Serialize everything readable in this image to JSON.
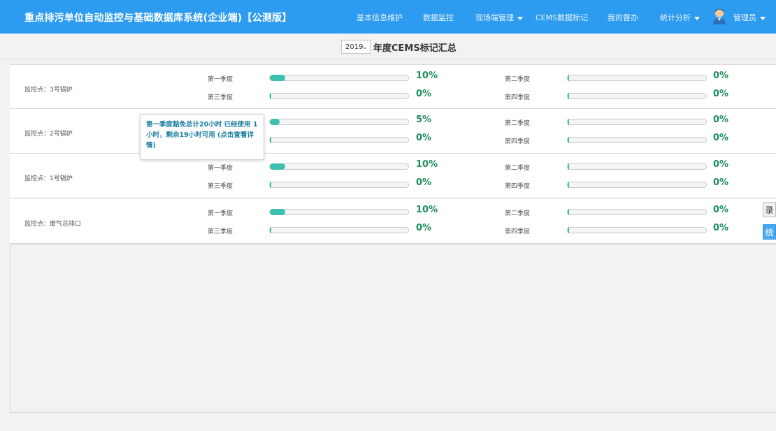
{
  "app": {
    "title": "重点排污单位自动监控与基础数据库系统(企业端)【公测版】"
  },
  "nav": {
    "items": [
      {
        "label": "基本信息维护",
        "dropdown": false
      },
      {
        "label": "数据监控",
        "dropdown": false
      },
      {
        "label": "现场端管理",
        "dropdown": true
      },
      {
        "label": "CEMS数据标记",
        "dropdown": false
      },
      {
        "label": "我的督办",
        "dropdown": false
      },
      {
        "label": "统计分析",
        "dropdown": true
      }
    ],
    "user": {
      "label": "管理员",
      "dropdown": true
    }
  },
  "year_bar": {
    "selected_year": "2019",
    "title": "年度CEMS标记汇总"
  },
  "quarter_labels": [
    "第一季度",
    "第二季度",
    "第三季度",
    "第四季度"
  ],
  "rows": [
    {
      "point": "监控点：3号锅炉",
      "q1": "10%",
      "q2": "0%",
      "q3": "0%",
      "q4": "0%",
      "q1_value": 0.1,
      "q2_value": 0,
      "q3_value": 0,
      "q4_value": 0
    },
    {
      "point": "监控点：2号锅炉",
      "q1": "5%",
      "q2": "0%",
      "q3": "0%",
      "q4": "0%",
      "q1_value": 0.05,
      "q2_value": 0,
      "q3_value": 0,
      "q4_value": 0
    },
    {
      "point": "监控点：1号锅炉",
      "q1": "10%",
      "q2": "0%",
      "q3": "0%",
      "q4": "0%",
      "q1_value": 0.1,
      "q2_value": 0,
      "q3_value": 0,
      "q4_value": 0
    },
    {
      "point": "监控点：废气总排口",
      "q1": "10%",
      "q2": "0%",
      "q3": "0%",
      "q4": "0%",
      "q1_value": 0.1,
      "q2_value": 0,
      "q3_value": 0,
      "q4_value": 0
    }
  ],
  "tooltip": {
    "text": "第一季度豁免总计20小时 已经使用 1小时，剩余19小时可用 (点击查看详情)"
  },
  "side_buttons": {
    "record": "录",
    "stats": "统"
  },
  "colors": {
    "header_bg": "#2d9bf0",
    "progress_fill": "#3cc0b0",
    "percent_text": "#1f8d5a",
    "tooltip_text": "#1b7fa0"
  }
}
